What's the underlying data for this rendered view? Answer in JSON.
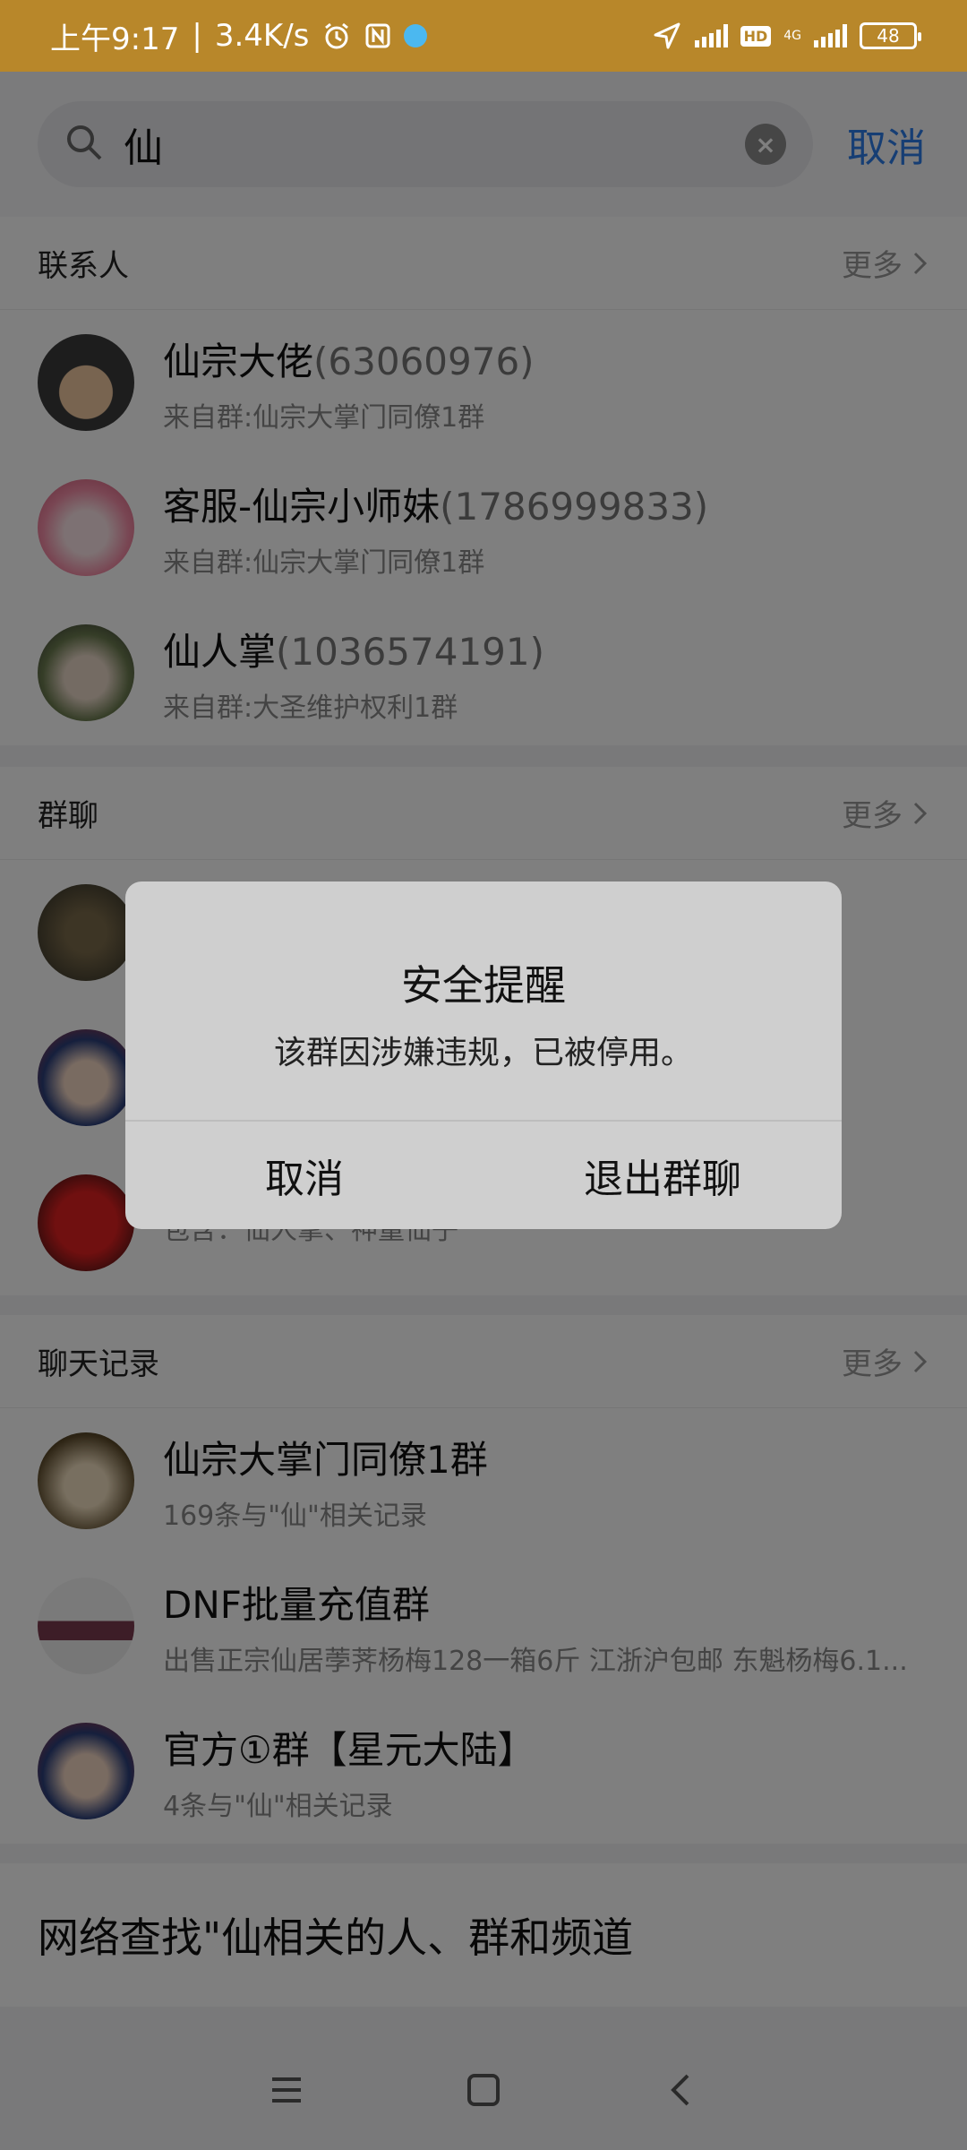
{
  "status_bar": {
    "time": "上午9:17",
    "speed": "3.4K/s",
    "battery": "48",
    "hd": "HD",
    "network": "4G"
  },
  "search": {
    "query": "仙",
    "cancel": "取消"
  },
  "contacts": {
    "title": "联系人",
    "more": "更多",
    "items": [
      {
        "name": "仙宗大佬",
        "id": "(63060976)",
        "sub": "来自群:仙宗大掌门同僚1群"
      },
      {
        "name": "客服-仙宗小师妹",
        "id": "(1786999833)",
        "sub": "来自群:仙宗大掌门同僚1群"
      },
      {
        "name": "仙人掌",
        "id": "(1036574191)",
        "sub": "来自群:大圣维护权利1群"
      }
    ]
  },
  "groups": {
    "title": "群聊",
    "more": "更多",
    "items": [
      {
        "name": "",
        "sub": ""
      },
      {
        "name": "",
        "sub": ""
      },
      {
        "name": "",
        "sub": "包含：仙人掌、神童仙子"
      }
    ]
  },
  "chat_records": {
    "title": "聊天记录",
    "more": "更多",
    "items": [
      {
        "name": "仙宗大掌门同僚1群",
        "sub": "169条与\"仙\"相关记录"
      },
      {
        "name": "DNF批量充值群",
        "sub": "出售正宗仙居荸荠杨梅128一箱6斤 江浙沪包邮  东魁杨梅6.1..."
      },
      {
        "name": "官方①群【星元大陆】",
        "sub": "4条与\"仙\"相关记录"
      }
    ]
  },
  "web_search": {
    "label": "网络查找\"仙相关的人、群和频道"
  },
  "dialog": {
    "title": "安全提醒",
    "message": "该群因涉嫌违规，已被停用。",
    "cancel": "取消",
    "confirm": "退出群聊"
  },
  "colors": {
    "status_bar": "#b8872a",
    "accent": "#2d7ce8"
  }
}
